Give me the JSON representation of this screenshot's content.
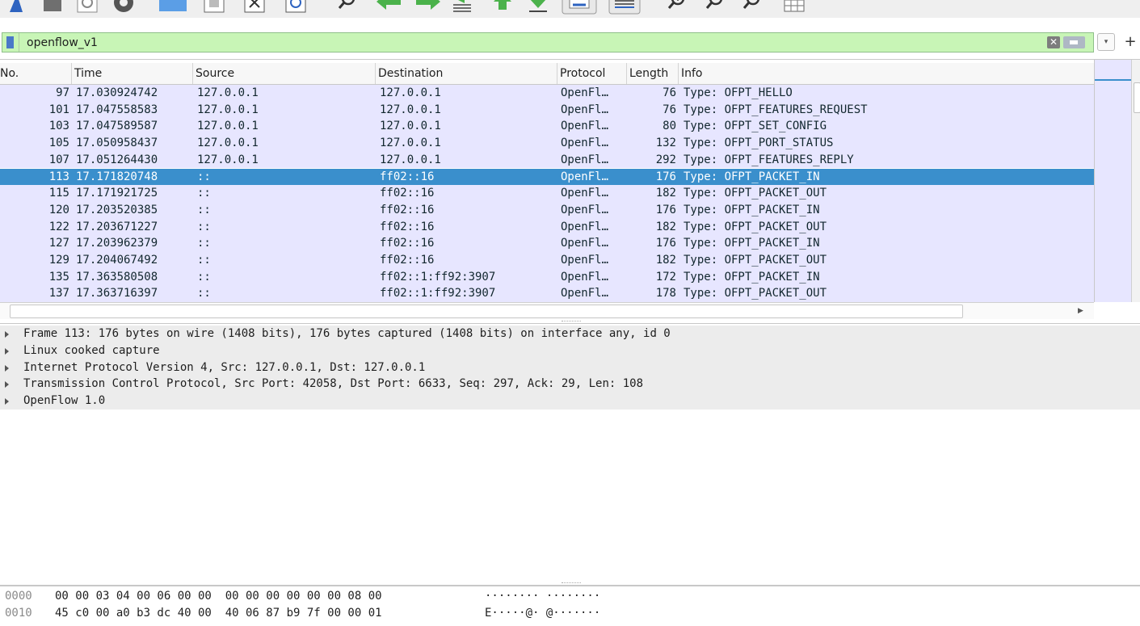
{
  "toolbar": {
    "icons": [
      "shark-fin-icon",
      "stop-capture-icon",
      "restart-capture-icon",
      "capture-options-icon",
      "open-file-icon",
      "save-file-icon",
      "close-file-icon",
      "reload-file-icon",
      "find-packet-icon",
      "go-back-icon",
      "go-forward-icon",
      "go-to-packet-icon",
      "go-first-icon",
      "go-last-icon",
      "autoscroll-icon",
      "colorize-icon",
      "zoom-in-icon",
      "zoom-out-icon",
      "normal-size-icon",
      "resize-columns-icon"
    ]
  },
  "filter": {
    "value": "openflow_v1",
    "clear_glyph": "✕",
    "dropdown_glyph": "▾",
    "add_glyph": "+",
    "background_color": "#c8f5b6"
  },
  "packet_list": {
    "columns": [
      "No.",
      "Time",
      "Source",
      "Destination",
      "Protocol",
      "Length",
      "Info"
    ],
    "rows": [
      {
        "no": "97",
        "time": "17.030924742",
        "src": "127.0.0.1",
        "dst": "127.0.0.1",
        "proto": "OpenFl…",
        "len": "76",
        "info": "Type: OFPT_HELLO"
      },
      {
        "no": "101",
        "time": "17.047558583",
        "src": "127.0.0.1",
        "dst": "127.0.0.1",
        "proto": "OpenFl…",
        "len": "76",
        "info": "Type: OFPT_FEATURES_REQUEST"
      },
      {
        "no": "103",
        "time": "17.047589587",
        "src": "127.0.0.1",
        "dst": "127.0.0.1",
        "proto": "OpenFl…",
        "len": "80",
        "info": "Type: OFPT_SET_CONFIG"
      },
      {
        "no": "105",
        "time": "17.050958437",
        "src": "127.0.0.1",
        "dst": "127.0.0.1",
        "proto": "OpenFl…",
        "len": "132",
        "info": "Type: OFPT_PORT_STATUS"
      },
      {
        "no": "107",
        "time": "17.051264430",
        "src": "127.0.0.1",
        "dst": "127.0.0.1",
        "proto": "OpenFl…",
        "len": "292",
        "info": "Type: OFPT_FEATURES_REPLY"
      },
      {
        "no": "113",
        "time": "17.171820748",
        "src": "::",
        "dst": "ff02::16",
        "proto": "OpenFl…",
        "len": "176",
        "info": "Type: OFPT_PACKET_IN"
      },
      {
        "no": "115",
        "time": "17.171921725",
        "src": "::",
        "dst": "ff02::16",
        "proto": "OpenFl…",
        "len": "182",
        "info": "Type: OFPT_PACKET_OUT"
      },
      {
        "no": "120",
        "time": "17.203520385",
        "src": "::",
        "dst": "ff02::16",
        "proto": "OpenFl…",
        "len": "176",
        "info": "Type: OFPT_PACKET_IN"
      },
      {
        "no": "122",
        "time": "17.203671227",
        "src": "::",
        "dst": "ff02::16",
        "proto": "OpenFl…",
        "len": "182",
        "info": "Type: OFPT_PACKET_OUT"
      },
      {
        "no": "127",
        "time": "17.203962379",
        "src": "::",
        "dst": "ff02::16",
        "proto": "OpenFl…",
        "len": "176",
        "info": "Type: OFPT_PACKET_IN"
      },
      {
        "no": "129",
        "time": "17.204067492",
        "src": "::",
        "dst": "ff02::16",
        "proto": "OpenFl…",
        "len": "182",
        "info": "Type: OFPT_PACKET_OUT"
      },
      {
        "no": "135",
        "time": "17.363580508",
        "src": "::",
        "dst": "ff02::1:ff92:3907",
        "proto": "OpenFl…",
        "len": "172",
        "info": "Type: OFPT_PACKET_IN"
      },
      {
        "no": "137",
        "time": "17.363716397",
        "src": "::",
        "dst": "ff02::1:ff92:3907",
        "proto": "OpenFl…",
        "len": "178",
        "info": "Type: OFPT_PACKET_OUT"
      }
    ],
    "selected_index": 5,
    "row_color": "#e7e6ff",
    "selected_color": "#3a8fcc"
  },
  "details": {
    "items": [
      "Frame 113: 176 bytes on wire (1408 bits), 176 bytes captured (1408 bits) on interface any, id 0",
      "Linux cooked capture",
      "Internet Protocol Version 4, Src: 127.0.0.1, Dst: 127.0.0.1",
      "Transmission Control Protocol, Src Port: 42058, Dst Port: 6633, Seq: 297, Ack: 29, Len: 108",
      "OpenFlow 1.0"
    ]
  },
  "hex": {
    "rows": [
      {
        "offset": "0000",
        "bytes": "00 00 03 04 00 06 00 00  00 00 00 00 00 00 08 00",
        "ascii": "········ ········"
      },
      {
        "offset": "0010",
        "bytes": "45 c0 00 a0 b3 dc 40 00  40 06 87 b9 7f 00 00 01",
        "ascii": "E·····@· @·······"
      }
    ]
  }
}
